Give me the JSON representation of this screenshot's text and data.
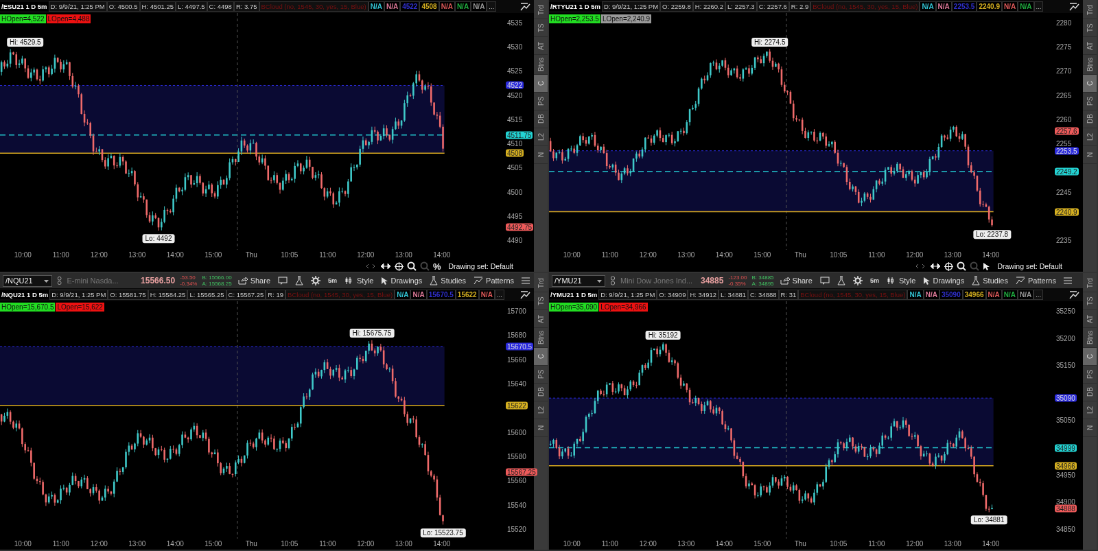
{
  "panels": [
    {
      "info": {
        "title": "/ESU21 1 D 5m",
        "fields": [
          "D: 9/9/21, 1:25 PM",
          "O: 4500.5",
          "H: 4501.25",
          "L: 4497.5",
          "C: 4498",
          "R: 3.75"
        ],
        "study": "BCloud (no, 1545, 30, yes, 15, Blue)",
        "indicators": [
          {
            "text": "N/A",
            "color": "#33c6d6"
          },
          {
            "text": "N/A",
            "color": "#e07a9a"
          },
          {
            "text": "4522",
            "color": "#3030d0"
          },
          {
            "text": "4508",
            "color": "#d6b020"
          },
          {
            "text": "N/A",
            "color": "#e05a5a"
          },
          {
            "text": "N/A",
            "color": "#20b040"
          },
          {
            "text": "N/A",
            "color": "#9a9a9a"
          }
        ],
        "more": "..."
      },
      "badges": [
        {
          "text": "HOpen=4,522",
          "color": "#22dd22"
        },
        {
          "text": "LOpen=4,488",
          "color": "#ee1111"
        }
      ],
      "y_ticks": [
        "4535",
        "4530",
        "4525",
        "4520",
        "4515",
        "4510",
        "4505",
        "4500",
        "4495",
        "4490"
      ],
      "price_tags": [
        {
          "kind": "cloud",
          "text": "4522",
          "color": "#2b2bdd"
        },
        {
          "kind": "mid",
          "text": "4511.75",
          "color": "#22d3d3"
        },
        {
          "kind": "open",
          "text": "4508",
          "color": "#d6b020"
        },
        {
          "kind": "last",
          "text": "4492.75",
          "color": "#ee5a5a"
        }
      ],
      "hi": "Hi: 4529.5",
      "lo": "Lo: 4492",
      "x_ticks": [
        "10:00",
        "11:00",
        "12:00",
        "13:00",
        "14:00",
        "15:00",
        "Thu",
        "10:05",
        "11:00",
        "12:00",
        "13:00",
        "14:00"
      ],
      "footer": {
        "icons": [
          {
            "kind": "pan"
          },
          {
            "kind": "crosshair"
          },
          {
            "kind": "zoom-in"
          },
          {
            "kind": "zoom-out"
          },
          {
            "kind": "percent",
            "label": "%"
          }
        ],
        "drawing_set": "Drawing set: Default"
      },
      "side_tabs": [
        {
          "label": "Trd",
          "selected": false
        },
        {
          "label": "TS",
          "selected": false
        },
        {
          "label": "AT",
          "selected": false
        },
        {
          "label": "Btns",
          "selected": false
        },
        {
          "label": "C",
          "selected": true
        },
        {
          "label": "PS",
          "selected": false
        },
        {
          "label": "DB",
          "selected": false
        },
        {
          "label": "L2",
          "selected": false
        },
        {
          "label": "N",
          "selected": false
        }
      ]
    },
    {
      "info": {
        "title": "/RTYU21 1 D 5m",
        "fields": [
          "D: 9/9/21, 1:25 PM",
          "O: 2259.8",
          "H: 2260.2",
          "L: 2257.3",
          "C: 2257.6",
          "R: 2.9"
        ],
        "study": "BCloud (no, 1545, 30, yes, 15, Blue)",
        "indicators": [
          {
            "text": "N/A",
            "color": "#33c6d6"
          },
          {
            "text": "N/A",
            "color": "#e07a9a"
          },
          {
            "text": "2253.5",
            "color": "#3030d0"
          },
          {
            "text": "2240.9",
            "color": "#d6b020"
          },
          {
            "text": "N/A",
            "color": "#e05a5a"
          },
          {
            "text": "N/A",
            "color": "#20b040"
          }
        ],
        "more": "..."
      },
      "badges": [
        {
          "text": "HOpen=2,253.5",
          "color": "#22dd22"
        },
        {
          "text": "LOpen=2,240.9",
          "color": "#999999"
        }
      ],
      "y_ticks": [
        "2280",
        "2275",
        "2270",
        "2265",
        "2260",
        "2255",
        "2245",
        "2235"
      ],
      "price_tags": [
        {
          "kind": "last",
          "text": "2257.6",
          "color": "#ee5a5a"
        },
        {
          "kind": "cloud",
          "text": "2253.5",
          "color": "#2b2bdd"
        },
        {
          "kind": "mid",
          "text": "2249.2",
          "color": "#22d3d3"
        },
        {
          "kind": "open",
          "text": "2240.9",
          "color": "#d6b020"
        }
      ],
      "hi": "Hi: 2274.5",
      "lo": "Lo: 2237.8",
      "x_ticks": [
        "10:00",
        "11:00",
        "12:00",
        "13:00",
        "14:00",
        "15:00",
        "Thu",
        "10:05",
        "11:00",
        "12:00",
        "13:00",
        "14:00"
      ],
      "footer": {
        "icons": [
          {
            "kind": "pan"
          },
          {
            "kind": "crosshair"
          },
          {
            "kind": "zoom-in"
          },
          {
            "kind": "zoom-out"
          },
          {
            "kind": "cursor"
          }
        ],
        "drawing_set": "Drawing set: Default"
      },
      "side_tabs": [
        {
          "label": "Trd",
          "selected": false
        },
        {
          "label": "TS",
          "selected": false
        },
        {
          "label": "AT",
          "selected": false
        },
        {
          "label": "Btns",
          "selected": false
        },
        {
          "label": "C",
          "selected": true
        },
        {
          "label": "PS",
          "selected": false
        },
        {
          "label": "DB",
          "selected": false
        },
        {
          "label": "L2",
          "selected": false
        },
        {
          "label": "N",
          "selected": false
        }
      ]
    },
    {
      "toolbar": {
        "symbol": "/NQU21",
        "description": "E-mini Nasda...",
        "last": "15566.50",
        "change": [
          "-53.50",
          "-0.34%"
        ],
        "bid_ask": [
          "B: 15566.00",
          "A: 15568.25"
        ],
        "buttons": [
          {
            "kind": "share",
            "label": "Share"
          },
          {
            "kind": "note"
          },
          {
            "kind": "flask"
          },
          {
            "kind": "gear"
          },
          {
            "kind": "timeframe",
            "label": "5m"
          },
          {
            "kind": "style",
            "label": "Style"
          },
          {
            "kind": "drawings",
            "label": "Drawings"
          },
          {
            "kind": "studies",
            "label": "Studies"
          },
          {
            "kind": "patterns",
            "label": "Patterns"
          },
          {
            "kind": "menu"
          }
        ]
      },
      "info": {
        "title": "/NQU21 1 D 5m",
        "fields": [
          "D: 9/9/21, 1:25 PM",
          "O: 15581.75",
          "H: 15584.25",
          "L: 15565.25",
          "C: 15567.25",
          "R: 19"
        ],
        "study": "BCloud (no, 1545, 30, yes, 15, Blue)",
        "indicators": [
          {
            "text": "N/A",
            "color": "#33c6d6"
          },
          {
            "text": "N/A",
            "color": "#e07a9a"
          },
          {
            "text": "15670.5",
            "color": "#3030d0"
          },
          {
            "text": "15622",
            "color": "#d6b020"
          },
          {
            "text": "N/A",
            "color": "#e05a5a"
          }
        ],
        "more": "..."
      },
      "badges": [
        {
          "text": "HOpen=15,670.5",
          "color": "#22dd22"
        },
        {
          "text": "LOpen=15,622",
          "color": "#ee1111"
        }
      ],
      "y_ticks": [
        "15700",
        "15680",
        "15660",
        "15640",
        "15600",
        "15580",
        "15560",
        "15540",
        "15520"
      ],
      "price_tags": [
        {
          "kind": "cloud",
          "text": "15670.5",
          "color": "#2b2bdd"
        },
        {
          "kind": "open",
          "text": "15622",
          "color": "#d6b020"
        },
        {
          "kind": "last",
          "text": "15567.25",
          "color": "#ee5a5a"
        }
      ],
      "hi": "Hi: 15675.75",
      "lo": "Lo: 15523.75",
      "x_ticks": [
        "10:00",
        "11:00",
        "12:00",
        "13:00",
        "14:00",
        "15:00",
        "Thu",
        "10:05",
        "11:00",
        "12:00",
        "13:00",
        "14:00"
      ],
      "side_tabs": [
        {
          "label": "Trd",
          "selected": false
        },
        {
          "label": "TS",
          "selected": false
        },
        {
          "label": "AT",
          "selected": false
        },
        {
          "label": "Btns",
          "selected": false
        },
        {
          "label": "C",
          "selected": true
        },
        {
          "label": "PS",
          "selected": false
        },
        {
          "label": "DB",
          "selected": false
        },
        {
          "label": "L2",
          "selected": false
        },
        {
          "label": "N",
          "selected": false
        }
      ]
    },
    {
      "toolbar": {
        "symbol": "/YMU21",
        "description": "Mini Dow Jones Ind...",
        "last": "34885",
        "change": [
          "-123.00",
          "-0.35%"
        ],
        "bid_ask": [
          "B: 34885",
          "A: 34895"
        ],
        "buttons": [
          {
            "kind": "share",
            "label": "Share"
          },
          {
            "kind": "note"
          },
          {
            "kind": "flask"
          },
          {
            "kind": "gear"
          },
          {
            "kind": "timeframe",
            "label": "5m"
          },
          {
            "kind": "style",
            "label": "Style"
          },
          {
            "kind": "drawings",
            "label": "Drawings"
          },
          {
            "kind": "studies",
            "label": "Studies"
          },
          {
            "kind": "patterns",
            "label": "Patterns"
          },
          {
            "kind": "menu"
          }
        ]
      },
      "info": {
        "title": "/YMU21 1 D 5m",
        "fields": [
          "D: 9/9/21, 1:25 PM",
          "O: 34909",
          "H: 34912",
          "L: 34881",
          "C: 34888",
          "R: 31"
        ],
        "study": "BCloud (no, 1545, 30, yes, 15, Blue)",
        "indicators": [
          {
            "text": "N/A",
            "color": "#33c6d6"
          },
          {
            "text": "N/A",
            "color": "#e07a9a"
          },
          {
            "text": "35090",
            "color": "#3030d0"
          },
          {
            "text": "34966",
            "color": "#d6b020"
          },
          {
            "text": "N/A",
            "color": "#e05a5a"
          },
          {
            "text": "N/A",
            "color": "#20b040"
          },
          {
            "text": "N/A",
            "color": "#9a9a9a"
          }
        ],
        "more": "..."
      },
      "badges": [
        {
          "text": "HOpen=35,090",
          "color": "#22dd22"
        },
        {
          "text": "LOpen=34,966",
          "color": "#ee1111"
        }
      ],
      "y_ticks": [
        "35250",
        "35200",
        "35150",
        "35050",
        "34950",
        "34900",
        "34850"
      ],
      "price_tags": [
        {
          "kind": "cloud",
          "text": "35090",
          "color": "#2b2bdd"
        },
        {
          "kind": "mid",
          "text": "34999",
          "color": "#22d3d3"
        },
        {
          "kind": "open",
          "text": "34966",
          "color": "#d6b020"
        },
        {
          "kind": "last",
          "text": "34888",
          "color": "#ee5a5a"
        }
      ],
      "hi": "Hi: 35192",
      "lo": "Lo: 34881",
      "x_ticks": [
        "10:00",
        "11:00",
        "12:00",
        "13:00",
        "14:00",
        "15:00",
        "Thu",
        "10:05",
        "11:00",
        "12:00",
        "13:00",
        "14:00"
      ],
      "side_tabs": [
        {
          "label": "Trd",
          "selected": false
        },
        {
          "label": "TS",
          "selected": false
        },
        {
          "label": "AT",
          "selected": false
        },
        {
          "label": "Btns",
          "selected": false
        },
        {
          "label": "C",
          "selected": true
        },
        {
          "label": "PS",
          "selected": false
        },
        {
          "label": "DB",
          "selected": false
        },
        {
          "label": "L2",
          "selected": false
        },
        {
          "label": "N",
          "selected": false
        }
      ]
    }
  ]
}
